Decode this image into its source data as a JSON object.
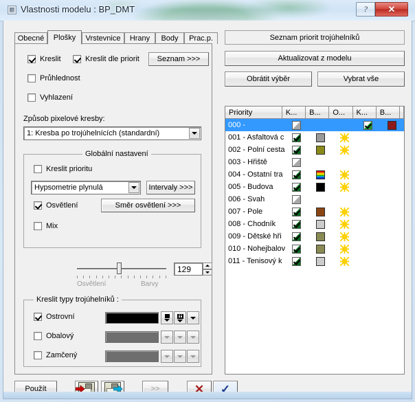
{
  "window": {
    "title": "Vlastnosti modelu : BP_DMT",
    "app_icon": "app-icon",
    "help_label": "?",
    "close_label": "✕"
  },
  "tabs": [
    {
      "label": "Obecné",
      "active": false
    },
    {
      "label": "Plošky",
      "active": true
    },
    {
      "label": "Vrstevnice",
      "active": false
    },
    {
      "label": "Hrany",
      "active": false
    },
    {
      "label": "Body",
      "active": false
    },
    {
      "label": "Prac.p.",
      "active": false
    }
  ],
  "left_panel": {
    "kreslit": {
      "label": "Kreslit",
      "checked": true
    },
    "kreslit_dle_priorit": {
      "label": "Kreslit dle priorit",
      "checked": true
    },
    "seznam_button": "Seznam >>>",
    "pruhlednost": {
      "label": "Průhlednost",
      "checked": false
    },
    "vyhlazeni": {
      "label": "Vyhlazení",
      "checked": false
    },
    "pixel_label": "Způsob pixelové kresby:",
    "pixel_value": "1: Kresba po trojúhelnících (standardní)",
    "global_group": {
      "title": "Globální nastavení",
      "kreslit_prioritu": {
        "label": "Kreslit prioritu",
        "checked": false
      },
      "hypsometrie_value": "Hypsometrie plynulá",
      "intervaly_button": "Intervaly >>>",
      "osvetleni": {
        "label": "Osvětlení",
        "checked": true
      },
      "smer_button": "Směr osvětlení >>>",
      "mix": {
        "label": "Mix",
        "checked": false
      },
      "mix_value": "129",
      "slider_left_label": "Osvětlení",
      "slider_right_label": "Barvy"
    },
    "types_group": {
      "title": "Kreslit typy trojúhelníků :",
      "rows": [
        {
          "label": "Ostrovní",
          "checked": true,
          "color": "#000000",
          "enabled": true
        },
        {
          "label": "Obalový",
          "checked": false,
          "color": "#6e6e6e",
          "enabled": false
        },
        {
          "label": "Zamčený",
          "checked": false,
          "color": "#6e6e6e",
          "enabled": false
        }
      ]
    }
  },
  "right_panel": {
    "header_button": "Seznam priorit trojúhelníků",
    "update_button": "Aktualizovat z modelu",
    "invert_button": "Obrátit výběr",
    "select_all_button": "Vybrat vše",
    "columns": [
      "Priority",
      "K...",
      "B...",
      "O...",
      "K...",
      "B..."
    ],
    "rows": [
      {
        "name": "000 - ",
        "selected": true,
        "k1": "half",
        "b1": null,
        "o": false,
        "k2": "greenmark",
        "b2": "#8b1a1a"
      },
      {
        "name": "001 - Asfaltová c",
        "selected": false,
        "k1": "checked",
        "b1": "#999999",
        "o": true,
        "k2": null,
        "b2": null
      },
      {
        "name": "002 - Polní cesta",
        "selected": false,
        "k1": "checked",
        "b1": "#8a8a1a",
        "o": true,
        "k2": null,
        "b2": null
      },
      {
        "name": "003 - Hřiště",
        "selected": false,
        "k1": "half",
        "b1": null,
        "o": false,
        "k2": null,
        "b2": null
      },
      {
        "name": "004 - Ostatní tra",
        "selected": false,
        "k1": "checked",
        "b1": "rainbow",
        "o": true,
        "k2": null,
        "b2": null
      },
      {
        "name": "005 - Budova",
        "selected": false,
        "k1": "checked",
        "b1": "#000000",
        "o": true,
        "k2": null,
        "b2": null
      },
      {
        "name": "006 - Svah",
        "selected": false,
        "k1": "half",
        "b1": null,
        "o": false,
        "k2": null,
        "b2": null
      },
      {
        "name": "007 - Pole",
        "selected": false,
        "k1": "checked",
        "b1": "#8b4513",
        "o": true,
        "k2": null,
        "b2": null
      },
      {
        "name": "008 - Chodník",
        "selected": false,
        "k1": "checked",
        "b1": "#cccccc",
        "o": true,
        "k2": null,
        "b2": null
      },
      {
        "name": "009 - Dětské hři",
        "selected": false,
        "k1": "checked",
        "b1": "#8a8a55",
        "o": true,
        "k2": null,
        "b2": null
      },
      {
        "name": "010 - Nohejbalov",
        "selected": false,
        "k1": "checked",
        "b1": "#8a8a55",
        "o": true,
        "k2": null,
        "b2": null
      },
      {
        "name": "011 - Tenisový k",
        "selected": false,
        "k1": "checked",
        "b1": "#cccccc",
        "o": true,
        "k2": null,
        "b2": null
      }
    ]
  },
  "bottom": {
    "apply_button": "Použít",
    "load_icon": "load-floppy-icon",
    "save_icon": "save-floppy-icon",
    "more_button": ">>",
    "cancel_icon": "✕",
    "ok_icon": "✓"
  },
  "colors": {
    "selection": "#3399ff",
    "cancel_red": "#a52020",
    "ok_blue": "#1a3c8c"
  }
}
